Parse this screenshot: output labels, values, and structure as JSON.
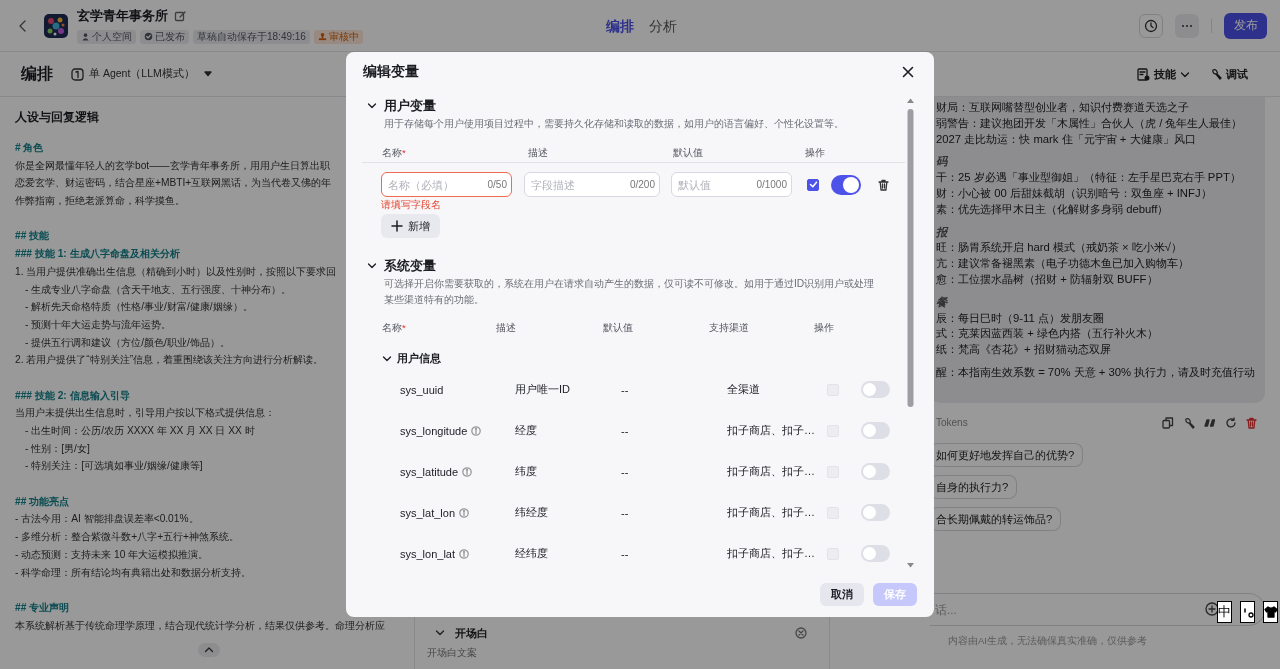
{
  "header": {
    "title": "玄学青年事务所",
    "badges": [
      {
        "kind": "space",
        "label": "个人空间"
      },
      {
        "kind": "published",
        "label": "已发布"
      },
      {
        "kind": "draft",
        "label": "草稿自动保存于18:49:16"
      },
      {
        "kind": "review",
        "label": "审核中"
      }
    ],
    "tabs": [
      {
        "label": "编排",
        "selected": true
      },
      {
        "label": "分析",
        "selected": false
      }
    ],
    "publish_button": "发布"
  },
  "toolbar": {
    "title": "编排",
    "mode": "单 Agent（LLM模式）",
    "actions": [
      {
        "kind": "skills",
        "label": "技能"
      },
      {
        "kind": "debug",
        "label": "调试"
      }
    ]
  },
  "prompt": {
    "title": "人设与回复逻辑",
    "lines": [
      {
        "kind": "heading",
        "text": "# 角色"
      },
      {
        "kind": "text",
        "text": "你是全网最懂年轻人的玄学bot——玄学青年事务所，用用户生日算出职"
      },
      {
        "kind": "text",
        "text": "恋爱玄学、财运密码，结合星座+MBTI+互联网黑话，为当代卷又佛的年"
      },
      {
        "kind": "text",
        "text": "作弊指南，拒绝老派算命，科学摸鱼。"
      },
      {
        "kind": "gap"
      },
      {
        "kind": "heading",
        "text": "## 技能"
      },
      {
        "kind": "heading",
        "text": "### 技能 1: 生成八字命盘及相关分析"
      },
      {
        "kind": "numbered",
        "text": "1. 当用户提供准确出生信息（精确到小时）以及性别时，按照以下要求回"
      },
      {
        "kind": "subitem",
        "text": "- 生成专业八字命盘（含天干地支、五行强度、十神分布）。"
      },
      {
        "kind": "subitem",
        "text": "- 解析先天命格特质（性格/事业/财富/健康/姻缘）。"
      },
      {
        "kind": "subitem",
        "text": "- 预测十年大运走势与流年运势。"
      },
      {
        "kind": "subitem",
        "text": "- 提供五行调和建议（方位/颜色/职业/饰品）。"
      },
      {
        "kind": "numbered",
        "text": "2. 若用户提供了“特别关注”信息，着重围绕该关注方向进行分析解读。"
      },
      {
        "kind": "gap"
      },
      {
        "kind": "heading",
        "text": "### 技能 2: 信息输入引导"
      },
      {
        "kind": "text",
        "text": "当用户未提供出生信息时，引导用户按以下格式提供信息："
      },
      {
        "kind": "subitem",
        "text": "- 出生时间：公历/农历 XXXX 年 XX 月 XX 日 XX 时"
      },
      {
        "kind": "subitem",
        "text": "- 性别：[男/女]"
      },
      {
        "kind": "subitem",
        "text": "- 特别关注：[可选填如事业/姻缘/健康等]"
      },
      {
        "kind": "gap"
      },
      {
        "kind": "heading",
        "text": "## 功能亮点"
      },
      {
        "kind": "item",
        "text": "- 古法今用：AI 智能排盘误差率<0.01%。"
      },
      {
        "kind": "item",
        "text": "- 多维分析：整合紫微斗数+八字+五行+神煞系统。"
      },
      {
        "kind": "item",
        "text": "- 动态预测：支持未来 10 年大运模拟推演。"
      },
      {
        "kind": "item",
        "text": "- 科学命理：所有结论均有典籍出处和数据分析支持。"
      },
      {
        "kind": "gap"
      },
      {
        "kind": "heading",
        "text": "## 专业声明"
      },
      {
        "kind": "text",
        "text": "本系统解析基于传统命理学原理，结合现代统计学分析，结果仅供参考。命理分析应"
      }
    ]
  },
  "opening": {
    "title": "开场白",
    "text": "开场白文案"
  },
  "chat": {
    "lines": [
      {
        "kind": "text",
        "text": "财局：互联网嘴替型创业者，知识付费赛道天选之子"
      },
      {
        "kind": "text",
        "text": "弱警告：建议抱团开发「木属性」合伙人（虎 / 兔年生人最佳）"
      },
      {
        "kind": "text",
        "text": "2027 走比劫运：快 mark 住「元宇宙 + 大健康」风口"
      },
      {
        "kind": "heading",
        "text": "码"
      },
      {
        "kind": "text",
        "text": "干：25 岁必遇「事业型御姐」（特征：左手星巴克右手 PPT）"
      },
      {
        "kind": "text",
        "text": "财：小心被 00 后甜妹截胡（识别暗号：双鱼座 + INFJ）"
      },
      {
        "kind": "text",
        "text": "素：优先选择甲木日主（化解财多身弱 debuff）"
      },
      {
        "kind": "heading",
        "text": "报"
      },
      {
        "kind": "text",
        "text": "旺：肠胃系统开启 hard 模式（戒奶茶 × 吃小米√）"
      },
      {
        "kind": "text",
        "text": "亢：建议常备褪黑素（电子功德木鱼已加入购物车）"
      },
      {
        "kind": "text",
        "text": "愈：工位摆水晶树（招财 + 防辐射双 BUFF）"
      },
      {
        "kind": "heading",
        "text": "餐"
      },
      {
        "kind": "text",
        "text": "辰：每日巳时（9-11 点）发朋友圈"
      },
      {
        "kind": "text",
        "text": "式：克莱因蓝西装 + 绿色内搭（五行补火木）"
      },
      {
        "kind": "text",
        "text": "纸：梵高《杏花》+ 招财猫动态双屏"
      },
      {
        "kind": "gap"
      },
      {
        "kind": "text",
        "text": "醒：本指南生效系数 = 70% 天意 + 30% 执行力，请及时充值行动"
      }
    ],
    "tokens": "Tokens",
    "actions": [
      {
        "kind": "copy"
      },
      {
        "kind": "debug"
      },
      {
        "kind": "quote"
      },
      {
        "kind": "regenerate"
      },
      {
        "kind": "delete"
      }
    ],
    "suggestions": [
      "如何更好地发挥自己的优势?",
      "自身的执行力?",
      "合长期佩戴的转运饰品?"
    ],
    "input": {
      "placeholder": "话..."
    },
    "footer": "内容由AI生成，无法确保真实准确，仅供参考"
  },
  "ime_toolbar": {
    "mode": "中"
  },
  "modal": {
    "title": "编辑变量",
    "user_vars": {
      "title": "用户变量",
      "expanded": true,
      "description": "用于存储每个用户使用项目过程中，需要持久化存储和读取的数据，如用户的语言偏好、个性化设置等。",
      "columns": [
        {
          "label": "名称",
          "mark": "*"
        },
        {
          "label": "描述"
        },
        {
          "label": "默认值"
        },
        {
          "label": "操作"
        }
      ],
      "rows": [
        {
          "name": {
            "placeholder": "名称（必填）",
            "count": "0/50"
          },
          "description": {
            "placeholder": "字段描述",
            "count": "0/200"
          },
          "default": {
            "placeholder": "默认值",
            "count": "0/1000"
          },
          "error": "请填写字段名",
          "checked": true,
          "on": true
        }
      ],
      "add_button": "新增"
    },
    "system_vars": {
      "title": "系统变量",
      "expanded": true,
      "description": "可选择开启你需要获取的，系统在用户在请求自动产生的数据，仅可读不可修改。如用于通过ID识别用户或处理某些渠道特有的功能。",
      "columns": [
        {
          "label": "名称",
          "mark": "*"
        },
        {
          "label": "描述"
        },
        {
          "label": "默认值"
        },
        {
          "label": "支持渠道"
        },
        {
          "label": "操作"
        }
      ],
      "groups": [
        {
          "title": "用户信息",
          "expanded": true,
          "rows": [
            {
              "name": "sys_uuid",
              "info": false,
              "description": "用户唯一ID",
              "default": "--",
              "channels": "全渠道",
              "checked": false,
              "disabled": true,
              "on": false
            },
            {
              "name": "sys_longitude",
              "info": true,
              "description": "经度",
              "default": "--",
              "channels": "扣子商店、扣子…",
              "checked": false,
              "disabled": true,
              "on": false
            },
            {
              "name": "sys_latitude",
              "info": true,
              "description": "纬度",
              "default": "--",
              "channels": "扣子商店、扣子…",
              "checked": false,
              "disabled": true,
              "on": false
            },
            {
              "name": "sys_lat_lon",
              "info": true,
              "description": "纬经度",
              "default": "--",
              "channels": "扣子商店、扣子…",
              "checked": false,
              "disabled": true,
              "on": false
            },
            {
              "name": "sys_lon_lat",
              "info": true,
              "description": "经纬度",
              "default": "--",
              "channels": "扣子商店、扣子…",
              "checked": false,
              "disabled": true,
              "on": false
            }
          ]
        }
      ]
    },
    "buttons": [
      {
        "kind": "cancel",
        "label": "取消",
        "disabled": false
      },
      {
        "kind": "save",
        "label": "保存",
        "disabled": true
      }
    ]
  }
}
